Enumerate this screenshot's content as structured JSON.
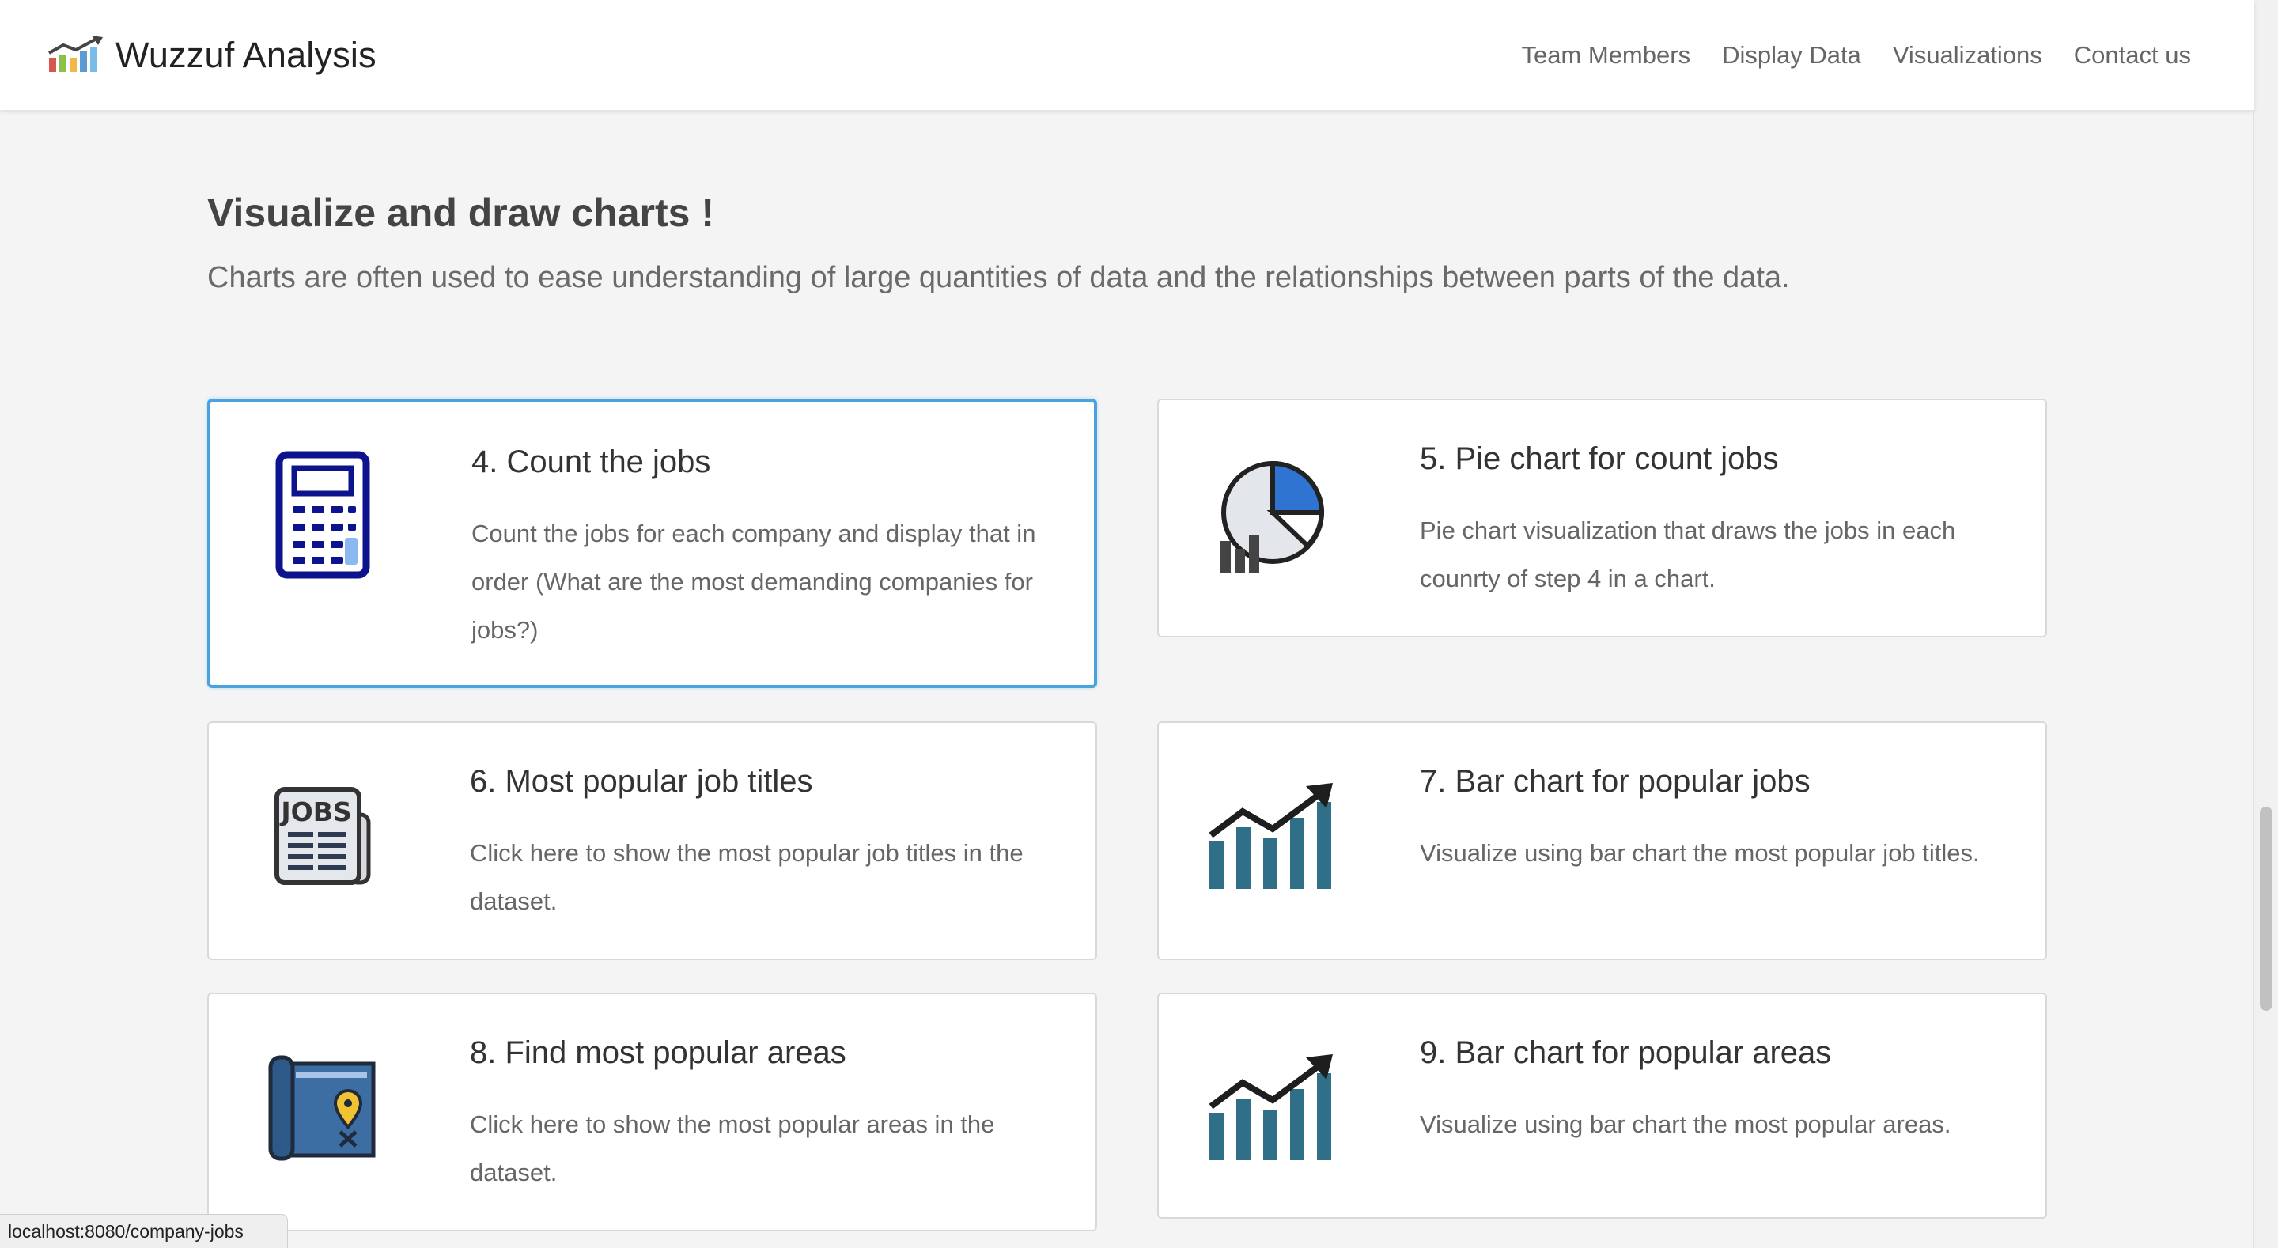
{
  "navbar": {
    "brand": "Wuzzuf Analysis",
    "logo_icon": "trend-bars-icon",
    "links": [
      "Team Members",
      "Display Data",
      "Visualizations",
      "Contact us"
    ]
  },
  "intro": {
    "title": "Visualize and draw charts !",
    "subtitle": "Charts are often used to ease understanding of large quantities of data and the relationships between parts of the data."
  },
  "cards": [
    {
      "title": "4. Count the jobs",
      "description": "Count the jobs for each company and display that in order (What are the most demanding companies for jobs?)",
      "icon": "calculator-icon",
      "active": true
    },
    {
      "title": "5. Pie chart for count jobs",
      "description": "Pie chart visualization that draws the jobs in each counrty of step 4 in a chart.",
      "icon": "pie-chart-icon",
      "active": false
    },
    {
      "title": "6. Most popular job titles",
      "description": "Click here to show the most popular job titles in the dataset.",
      "icon": "newspaper-jobs-icon",
      "icon_text": "JOBS",
      "active": false
    },
    {
      "title": "7. Bar chart for popular jobs",
      "description": "Visualize using bar chart the most popular job titles.",
      "icon": "bar-chart-trend-icon",
      "active": false
    },
    {
      "title": "8. Find most popular areas",
      "description": "Click here to show the most popular areas in the dataset.",
      "icon": "map-location-icon",
      "active": false
    },
    {
      "title": "9. Bar chart for popular areas",
      "description": "Visualize using bar chart the most popular areas.",
      "icon": "bar-chart-trend-icon",
      "active": false
    }
  ],
  "status_bar": {
    "url": "localhost:8080/company-jobs"
  },
  "colors": {
    "accent_border": "#4aa3df",
    "icon_navy": "#0c138c",
    "icon_teal": "#2f6f87",
    "pie_blue": "#2f74d0"
  }
}
